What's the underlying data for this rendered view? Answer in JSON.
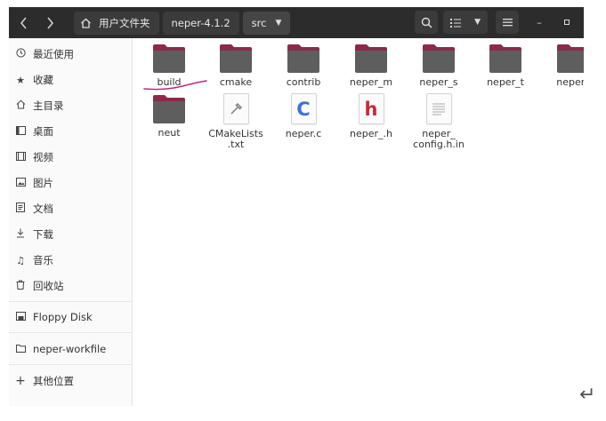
{
  "header": {
    "breadcrumbs": [
      "用户文件夹",
      "neper-4.1.2",
      "src"
    ],
    "back_icon": "chevron-left-icon",
    "forward_icon": "chevron-right-icon",
    "search_icon": "search-icon",
    "view_list_icon": "list-view-icon",
    "menu_icon": "hamburger-menu-icon",
    "minimize_symbol": "–",
    "maximize_symbol": "▫"
  },
  "sidebar": {
    "items": [
      {
        "label": "最近使用",
        "icon": "clock-icon"
      },
      {
        "label": "收藏",
        "icon": "star-icon"
      },
      {
        "label": "主目录",
        "icon": "home-icon"
      },
      {
        "label": "桌面",
        "icon": "desktop-icon"
      },
      {
        "label": "视频",
        "icon": "video-icon"
      },
      {
        "label": "图片",
        "icon": "picture-icon"
      },
      {
        "label": "文档",
        "icon": "document-icon"
      },
      {
        "label": "下载",
        "icon": "download-icon"
      },
      {
        "label": "音乐",
        "icon": "music-icon"
      },
      {
        "label": "回收站",
        "icon": "trash-icon"
      },
      {
        "label": "Floppy Disk",
        "icon": "floppy-disk-icon"
      },
      {
        "label": "neper-workfile",
        "icon": "folder-icon"
      },
      {
        "label": "其他位置",
        "icon": "plus-icon"
      }
    ]
  },
  "files": [
    {
      "name": "build",
      "kind": "folder"
    },
    {
      "name": "cmake",
      "kind": "folder"
    },
    {
      "name": "contrib",
      "kind": "folder"
    },
    {
      "name": "neper_m",
      "kind": "folder"
    },
    {
      "name": "neper_s",
      "kind": "folder"
    },
    {
      "name": "neper_t",
      "kind": "folder"
    },
    {
      "name": "neper_",
      "kind": "folder"
    },
    {
      "name": "neut",
      "kind": "folder"
    },
    {
      "name": "CMakeLists\n.txt",
      "kind": "cmake-file"
    },
    {
      "name": "neper.c",
      "kind": "c-source"
    },
    {
      "name": "neper_.h",
      "kind": "c-header"
    },
    {
      "name": "neper_\nconfig.h.in",
      "kind": "text-file"
    }
  ],
  "colors": {
    "folder_body": "#5e5e5e",
    "folder_tab": "#8c2a4a",
    "headerbar": "#2c2c2c",
    "annotation": "#c0287a",
    "c_glyph": "#3f72d6",
    "h_glyph": "#c42b3b"
  },
  "annotation": {
    "return_symbol": "↵"
  }
}
